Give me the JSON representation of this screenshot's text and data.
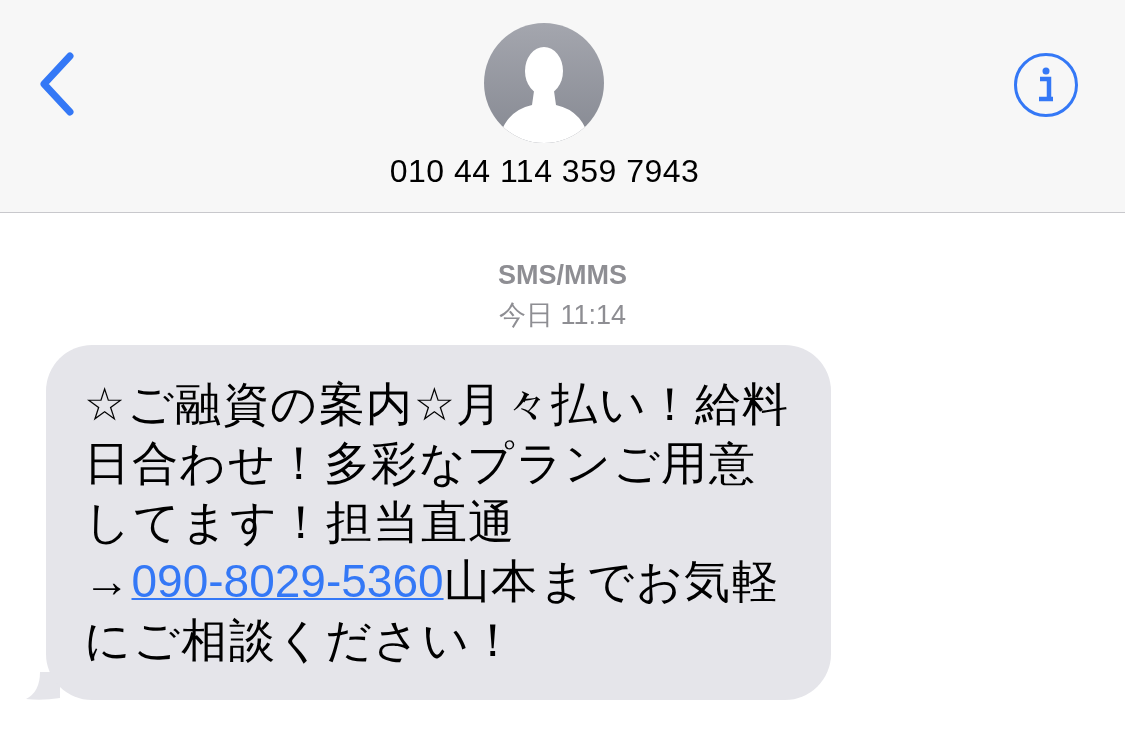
{
  "header": {
    "contact": {
      "number": "010 44 114 359 7943"
    }
  },
  "thread": {
    "service_label": "SMS/MMS",
    "timestamp": "今日 11:14",
    "messages": [
      {
        "kind": "incoming",
        "text_before": "☆ご融資の案内☆月々払い！給料日合わせ！多彩なプランご用意してます！担当直通→",
        "link": "090-8029-5360",
        "text_after": "山本までお気軽にご相談ください！"
      }
    ]
  }
}
